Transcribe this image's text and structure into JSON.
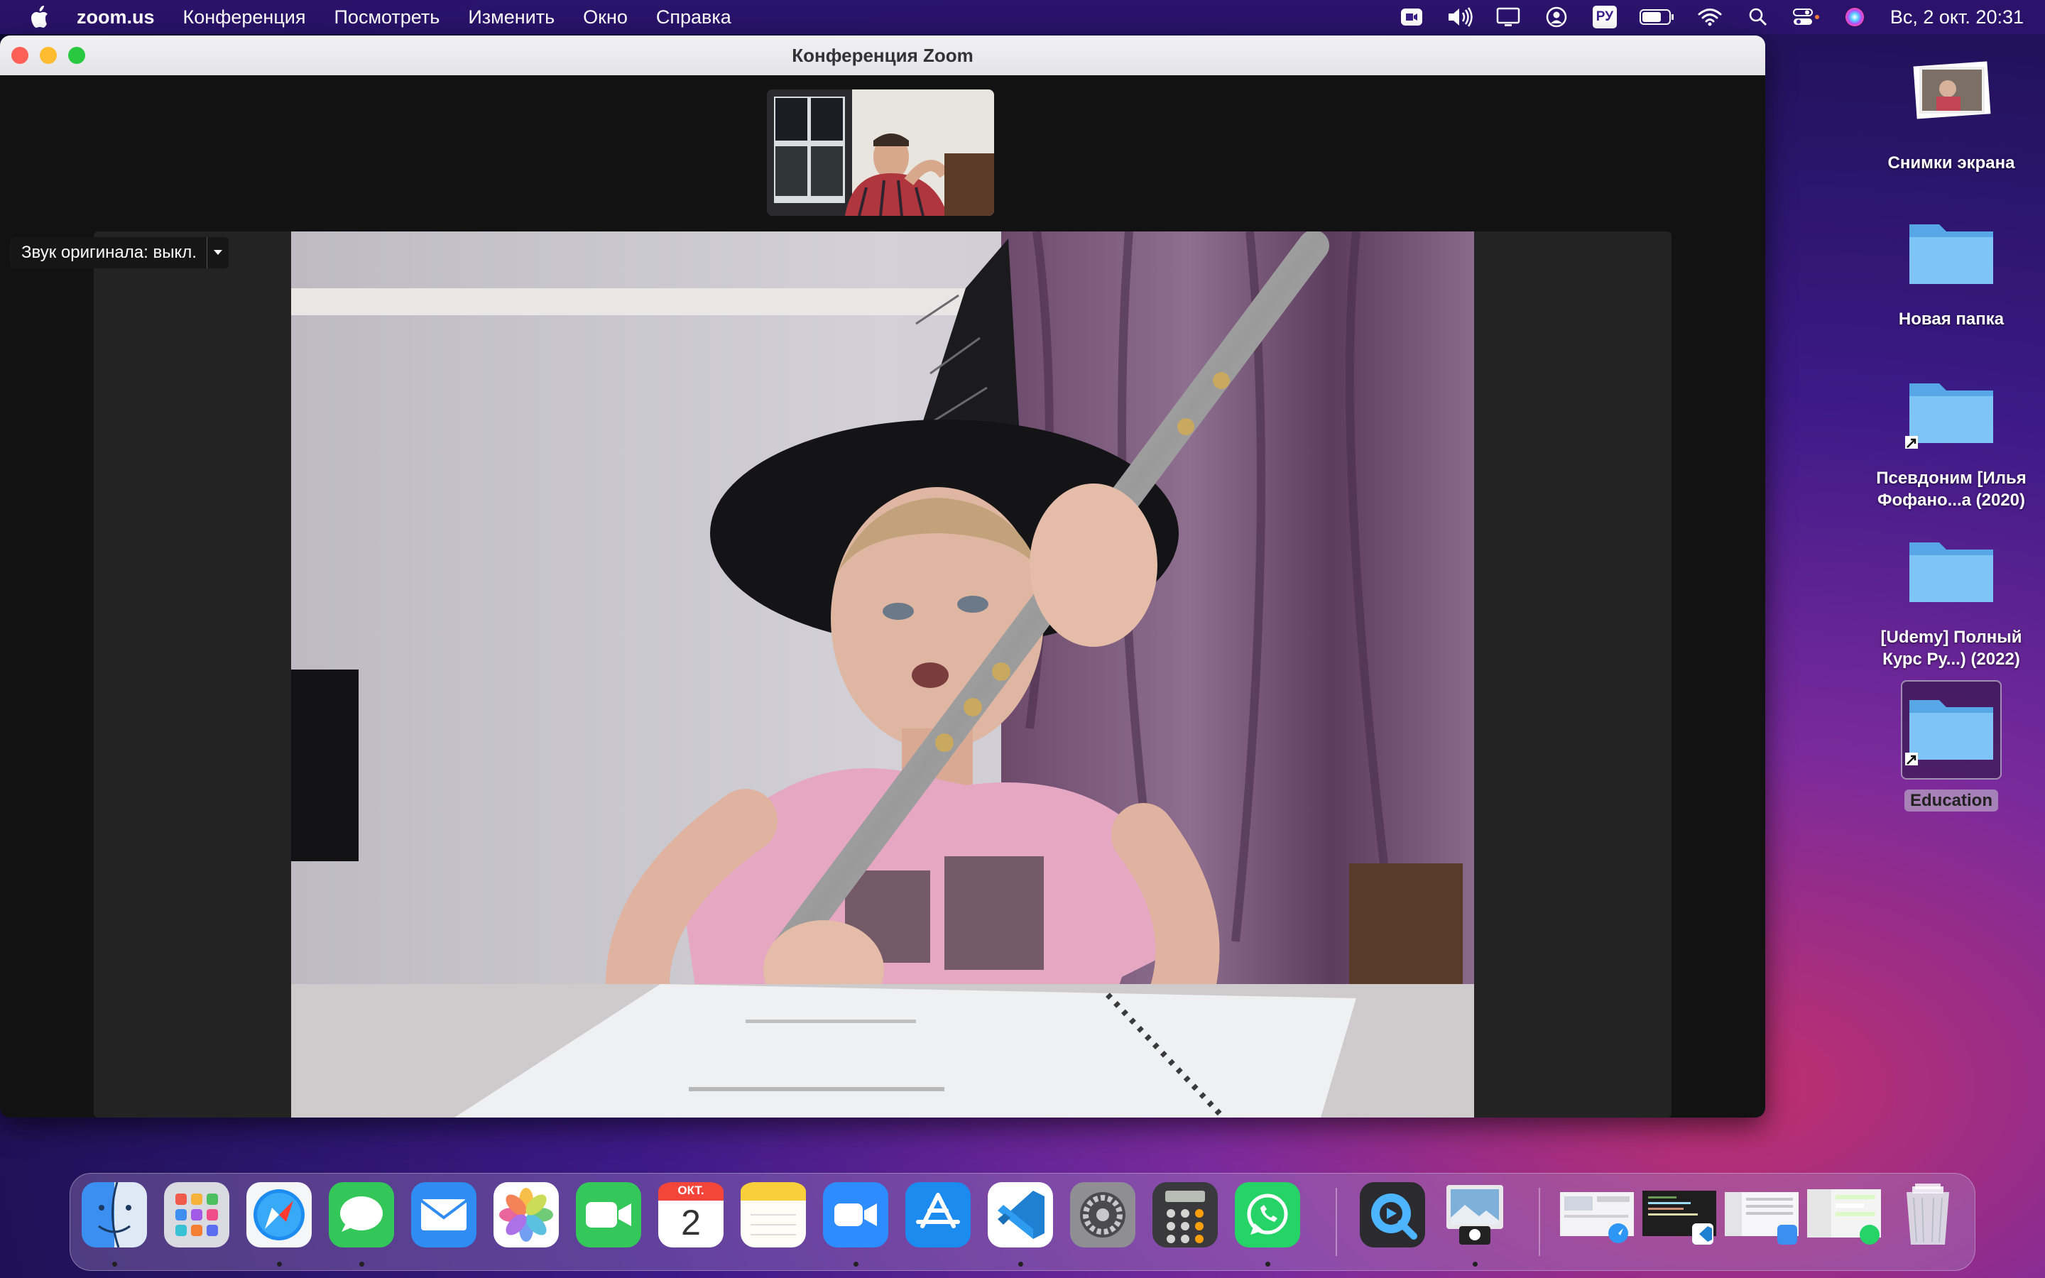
{
  "menubar": {
    "apple_icon": "apple-logo-icon",
    "app_name": "zoom.us",
    "menus": [
      "Конференция",
      "Посмотреть",
      "Изменить",
      "Окно",
      "Справка"
    ],
    "status_icons": [
      "zoom-video-icon",
      "volume-icon",
      "display-mirror-icon",
      "user-icon",
      "keyboard-language-icon",
      "battery-icon",
      "wifi-icon",
      "spotlight-search-icon",
      "control-center-icon",
      "siri-icon"
    ],
    "language": "РУ",
    "clock": "Вс, 2 окт.  20:31"
  },
  "window": {
    "title": "Конференция Zoom",
    "audio_label": "Звук оригинала: выкл."
  },
  "desktop": {
    "items": [
      {
        "label": "Снимки экрана",
        "type": "stack"
      },
      {
        "label": "Новая папка",
        "type": "folder"
      },
      {
        "label_line1": "Псевдоним [Илья",
        "label_line2": "Фофано...а (2020)",
        "type": "alias"
      },
      {
        "label_line1": "[Udemy] Полный",
        "label_line2": "Курс Ру...) (2022)",
        "type": "folder"
      },
      {
        "label": "Education",
        "type": "alias",
        "selected": true
      }
    ]
  },
  "dock": {
    "apps": [
      "Finder",
      "Launchpad",
      "Safari",
      "Messages",
      "Mail",
      "Photos",
      "FaceTime",
      "Calendar",
      "Notes",
      "Zoom",
      "App Store",
      "Visual Studio Code",
      "System Preferences",
      "Calculator",
      "WhatsApp",
      "QuickTime Player",
      "Preview"
    ],
    "calendar_month": "ОКТ.",
    "calendar_day": "2",
    "minimized": [
      "window-safari",
      "window-vscode",
      "window-finder",
      "window-whatsapp"
    ],
    "trash": "Trash"
  }
}
